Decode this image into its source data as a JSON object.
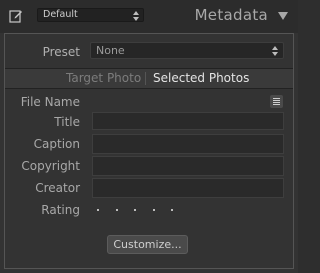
{
  "header": {
    "preset_value": "Default",
    "title": "Metadata"
  },
  "preset": {
    "label": "Preset",
    "value": "None"
  },
  "tabs": [
    {
      "label": "Target Photo",
      "active": false
    },
    {
      "label": "Selected Photos",
      "active": true
    }
  ],
  "fields": {
    "file_name": {
      "label": "File Name",
      "value": ""
    },
    "title": {
      "label": "Title",
      "value": ""
    },
    "caption": {
      "label": "Caption",
      "value": ""
    },
    "copyright": {
      "label": "Copyright",
      "value": ""
    },
    "creator": {
      "label": "Creator",
      "value": ""
    },
    "rating": {
      "label": "Rating",
      "value": 0,
      "max": 5
    }
  },
  "customize_label": "Customize..."
}
